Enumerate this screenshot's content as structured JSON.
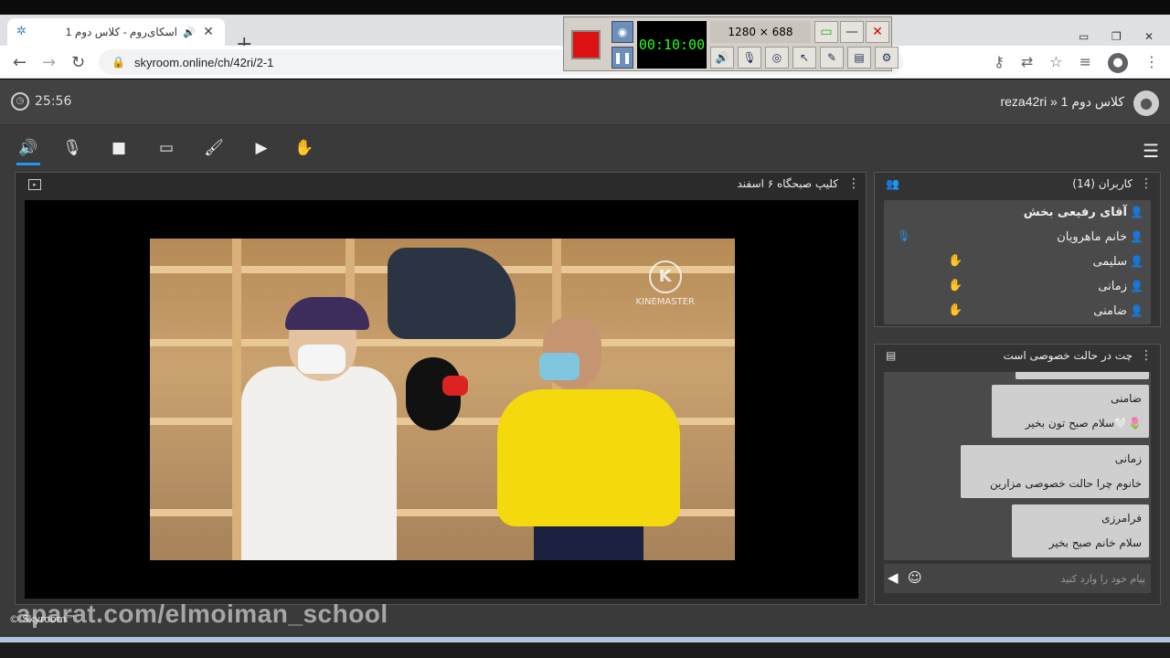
{
  "browser": {
    "tab_title": "اسکای‌روم - کلاس دوم 1",
    "url": "skyroom.online/ch/42ri/2-1"
  },
  "recorder": {
    "time": "00:10:00",
    "size": "1280 × 688"
  },
  "header": {
    "timer": "25:56",
    "room_title": "reza42ri » کلاس دوم 1"
  },
  "stage": {
    "title": "کلیپ صبحگاه ۶ اسفند",
    "video_watermark": "KINEMASTER"
  },
  "users": {
    "title": "کاربران (14)",
    "list": [
      {
        "name": "آقای رفیعی بخش",
        "role": "presenter",
        "hand": false,
        "mic": false
      },
      {
        "name": "خانم ماهرویان",
        "role": "presenter",
        "hand": false,
        "mic": true
      },
      {
        "name": "سلیمی",
        "role": "user",
        "hand": true,
        "mic": false
      },
      {
        "name": "زمانی",
        "role": "user",
        "hand": true,
        "mic": false
      },
      {
        "name": "ضامنی",
        "role": "user",
        "hand": true,
        "mic": false
      }
    ]
  },
  "chat": {
    "title": "چت در حالت خصوصی است",
    "messages": [
      {
        "from": "ضامنی",
        "text": "سلام صبح تون بخیر🤍🌷"
      },
      {
        "from": "زمانی",
        "text": "خانوم چرا حالت خصوصی مزارین"
      },
      {
        "from": "فرامرزی",
        "text": "سلام خانم صبح بخیر"
      }
    ],
    "placeholder": "پیام خود را وارد کنید"
  },
  "footer": {
    "copyright": "© Skyroom™",
    "watermark": "aparat.com/elmoiman_school"
  },
  "colors": {
    "accent": "#2196f3",
    "panel_bg": "#333333",
    "app_bg": "#3a3a3a"
  }
}
